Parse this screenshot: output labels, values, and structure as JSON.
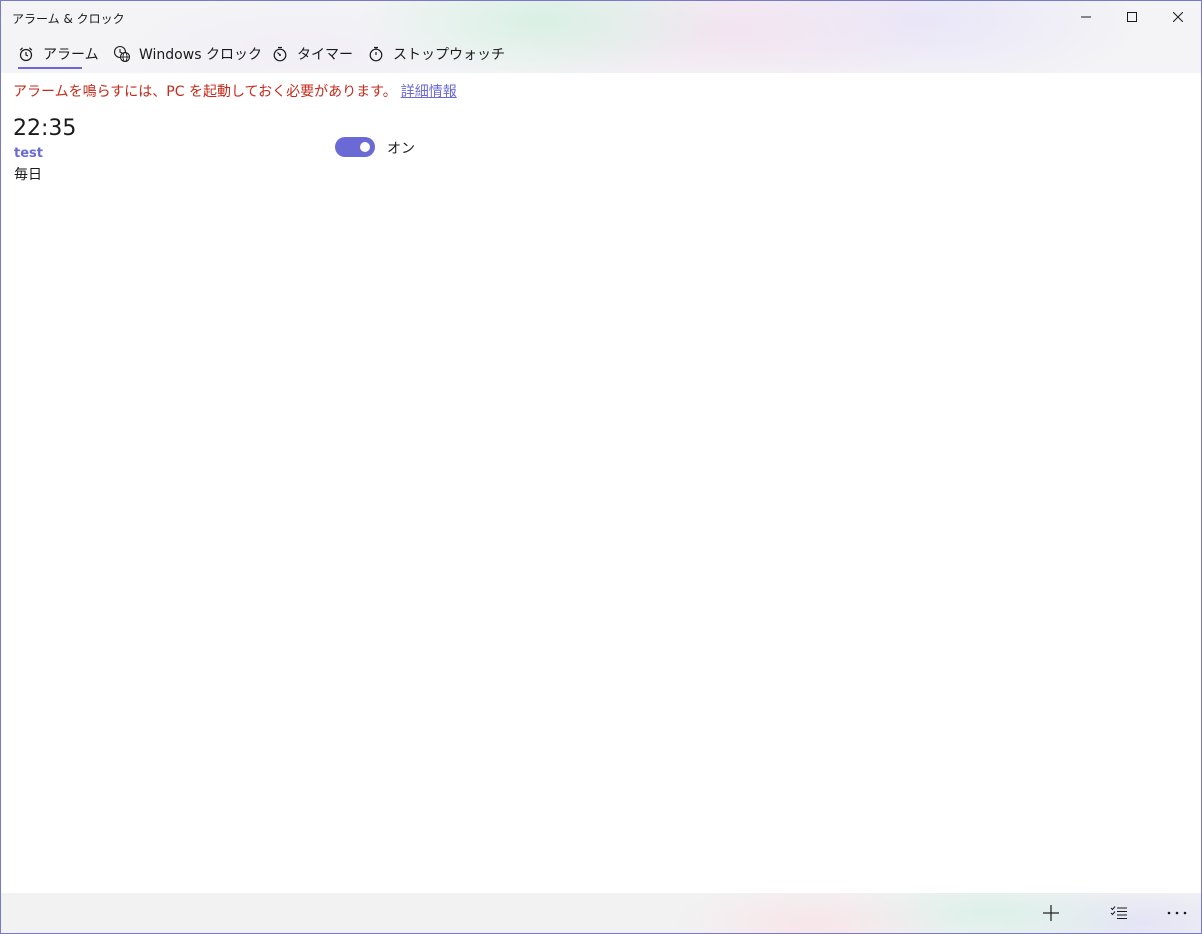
{
  "window": {
    "title": "アラーム & クロック"
  },
  "tabs": [
    {
      "label": "アラーム",
      "icon": "alarm-clock-icon",
      "selected": true
    },
    {
      "label": "Windows クロック",
      "icon": "world-clock-icon",
      "selected": false
    },
    {
      "label": "タイマー",
      "icon": "timer-icon",
      "selected": false
    },
    {
      "label": "ストップウォッチ",
      "icon": "stopwatch-icon",
      "selected": false
    }
  ],
  "notice": {
    "text": "アラームを鳴らすには、PC を起動しておく必要があります。",
    "link": "詳細情報"
  },
  "alarms": [
    {
      "time": "22:35",
      "name": "test",
      "repeat": "毎日",
      "toggle_label": "オン",
      "enabled": true
    }
  ],
  "bottom_bar": {
    "buttons": [
      "add-icon",
      "select-icon",
      "more-icon"
    ]
  },
  "colors": {
    "accent": "#6b69d6",
    "warning": "#c42b1c",
    "text": "#1a1a1a"
  }
}
